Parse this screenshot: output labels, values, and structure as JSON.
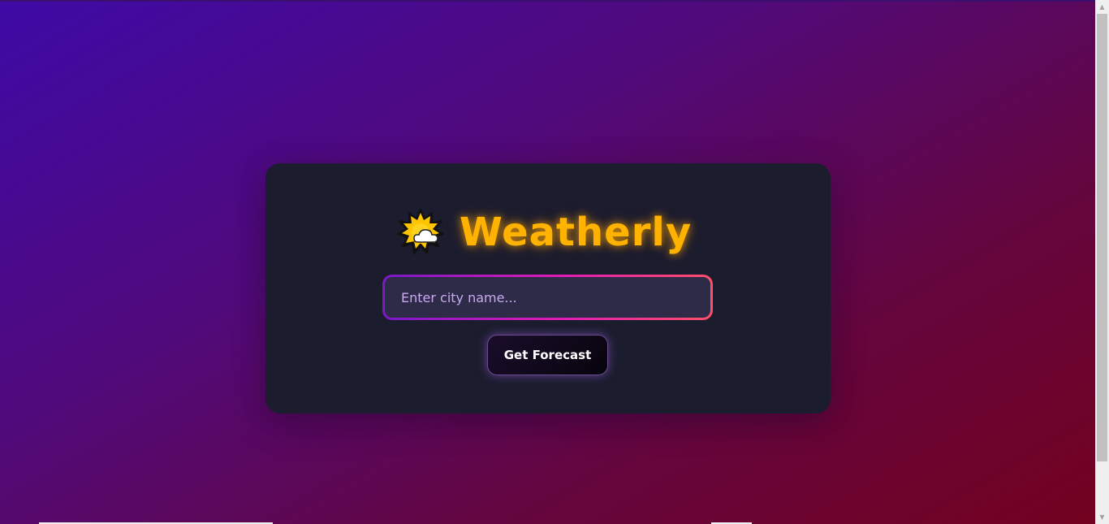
{
  "app": {
    "title": "Weatherly",
    "logo_icon": "sun-behind-cloud-icon"
  },
  "search": {
    "placeholder": "Enter city name...",
    "value": ""
  },
  "actions": {
    "forecast_label": "Get Forecast"
  },
  "colors": {
    "title": "#ffb300",
    "card": "#1b1c2e",
    "input_border_start": "#7a18c8",
    "input_border_end": "#ff4f68",
    "background_start": "#3e0aa6",
    "background_end": "#73021f"
  }
}
